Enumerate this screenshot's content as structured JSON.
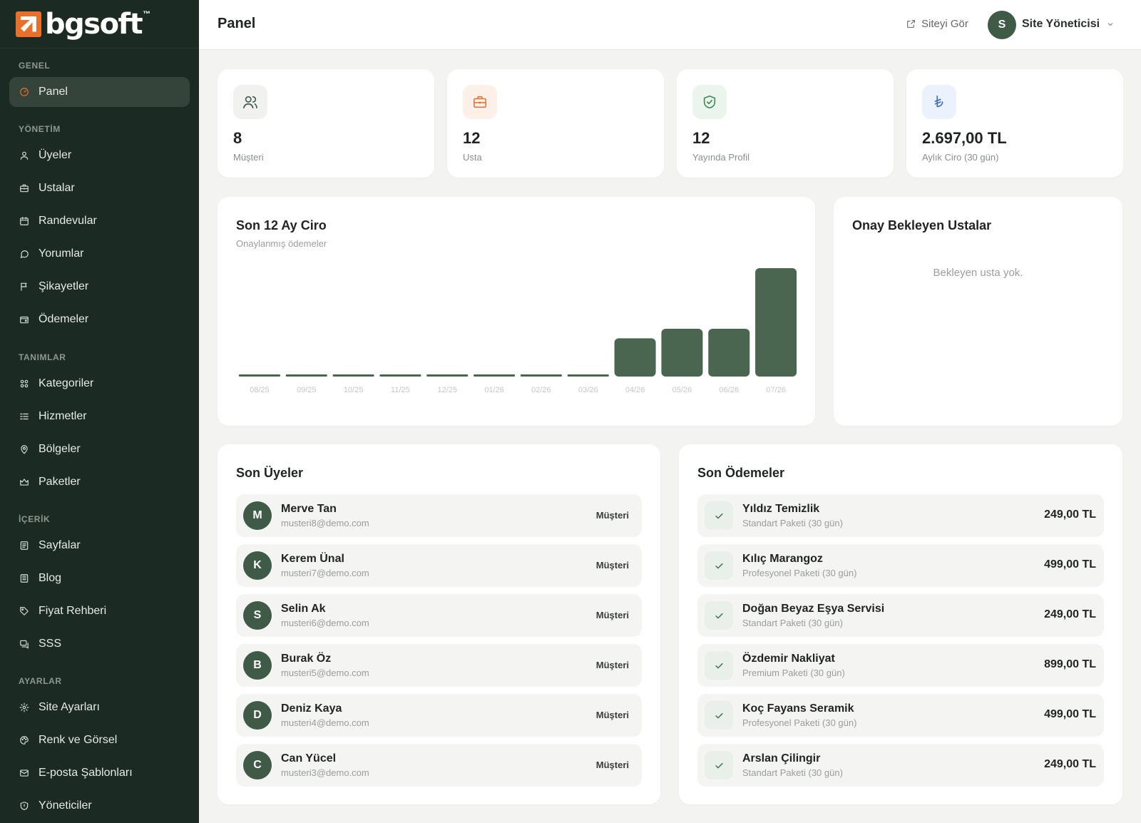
{
  "brand": {
    "name": "bgsoft",
    "tm": "™"
  },
  "sidebar": {
    "sections": [
      {
        "title": "GENEL",
        "items": [
          {
            "label": "Panel",
            "icon": "gauge-icon",
            "active": true
          }
        ]
      },
      {
        "title": "YÖNETİM",
        "items": [
          {
            "label": "Üyeler",
            "icon": "user-icon"
          },
          {
            "label": "Ustalar",
            "icon": "briefcase-icon"
          },
          {
            "label": "Randevular",
            "icon": "calendar-icon"
          },
          {
            "label": "Yorumlar",
            "icon": "comment-icon"
          },
          {
            "label": "Şikayetler",
            "icon": "flag-icon"
          },
          {
            "label": "Ödemeler",
            "icon": "wallet-icon"
          }
        ]
      },
      {
        "title": "TANIMLAR",
        "items": [
          {
            "label": "Kategoriler",
            "icon": "grid-icon"
          },
          {
            "label": "Hizmetler",
            "icon": "list-icon"
          },
          {
            "label": "Bölgeler",
            "icon": "pin-icon"
          },
          {
            "label": "Paketler",
            "icon": "crown-icon"
          }
        ]
      },
      {
        "title": "İÇERİK",
        "items": [
          {
            "label": "Sayfalar",
            "icon": "page-icon"
          },
          {
            "label": "Blog",
            "icon": "doc-icon"
          },
          {
            "label": "Fiyat Rehberi",
            "icon": "tag-icon"
          },
          {
            "label": "SSS",
            "icon": "chat-icon"
          }
        ]
      },
      {
        "title": "AYARLAR",
        "items": [
          {
            "label": "Site Ayarları",
            "icon": "gear-icon"
          },
          {
            "label": "Renk ve Görsel",
            "icon": "palette-icon"
          },
          {
            "label": "E-posta Şablonları",
            "icon": "mail-icon"
          },
          {
            "label": "Yöneticiler",
            "icon": "shield-icon"
          }
        ]
      }
    ]
  },
  "header": {
    "title": "Panel",
    "view_site": "Siteyi Gör",
    "user_initial": "S",
    "user_name": "Site Yöneticisi"
  },
  "stats": [
    {
      "value": "8",
      "label": "Müşteri",
      "icon": "users-icon",
      "bg": "#f1f2f0",
      "stroke": "#3f5a47"
    },
    {
      "value": "12",
      "label": "Usta",
      "icon": "briefcase-icon",
      "bg": "#fdf0e8",
      "stroke": "#e07a3c"
    },
    {
      "value": "12",
      "label": "Yayında Profil",
      "icon": "shield-check-icon",
      "bg": "#ebf5ee",
      "stroke": "#3d8a57"
    },
    {
      "value": "2.697,00 TL",
      "label": "Aylık Ciro (30 gün)",
      "icon": "lira-icon",
      "bg": "#ecf2fb",
      "stroke": "#3b6ecb"
    }
  ],
  "revenue": {
    "title": "Son 12 Ay Ciro",
    "subtitle": "Onaylanmış ödemeler"
  },
  "chart_data": {
    "type": "bar",
    "title": "Son 12 Ay Ciro",
    "subtitle": "Onaylanmış ödemeler",
    "categories": [
      "08/25",
      "09/25",
      "10/25",
      "11/25",
      "12/25",
      "01/26",
      "02/26",
      "03/26",
      "04/26",
      "05/26",
      "06/26",
      "07/26"
    ],
    "values": [
      0,
      0,
      0,
      0,
      0,
      0,
      0,
      0,
      1200,
      1500,
      1500,
      3400
    ],
    "ylim": [
      0,
      3400
    ],
    "color": "#4a6651",
    "grid": false
  },
  "pending": {
    "title": "Onay Bekleyen Ustalar",
    "empty": "Bekleyen usta yok."
  },
  "members": {
    "title": "Son Üyeler",
    "items": [
      {
        "initial": "M",
        "name": "Merve Tan",
        "email": "musteri8@demo.com",
        "role": "Müşteri"
      },
      {
        "initial": "K",
        "name": "Kerem Ünal",
        "email": "musteri7@demo.com",
        "role": "Müşteri"
      },
      {
        "initial": "S",
        "name": "Selin Ak",
        "email": "musteri6@demo.com",
        "role": "Müşteri"
      },
      {
        "initial": "B",
        "name": "Burak Öz",
        "email": "musteri5@demo.com",
        "role": "Müşteri"
      },
      {
        "initial": "D",
        "name": "Deniz Kaya",
        "email": "musteri4@demo.com",
        "role": "Müşteri"
      },
      {
        "initial": "C",
        "name": "Can Yücel",
        "email": "musteri3@demo.com",
        "role": "Müşteri"
      }
    ]
  },
  "payments": {
    "title": "Son Ödemeler",
    "items": [
      {
        "name": "Yıldız Temizlik",
        "plan": "Standart Paketi (30 gün)",
        "amount": "249,00 TL"
      },
      {
        "name": "Kılıç Marangoz",
        "plan": "Profesyonel Paketi (30 gün)",
        "amount": "499,00 TL"
      },
      {
        "name": "Doğan Beyaz Eşya Servisi",
        "plan": "Standart Paketi (30 gün)",
        "amount": "249,00 TL"
      },
      {
        "name": "Özdemir Nakliyat",
        "plan": "Premium Paketi (30 gün)",
        "amount": "899,00 TL"
      },
      {
        "name": "Koç Fayans Seramik",
        "plan": "Profesyonel Paketi (30 gün)",
        "amount": "499,00 TL"
      },
      {
        "name": "Arslan Çilingir",
        "plan": "Standart Paketi (30 gün)",
        "amount": "249,00 TL"
      }
    ]
  }
}
